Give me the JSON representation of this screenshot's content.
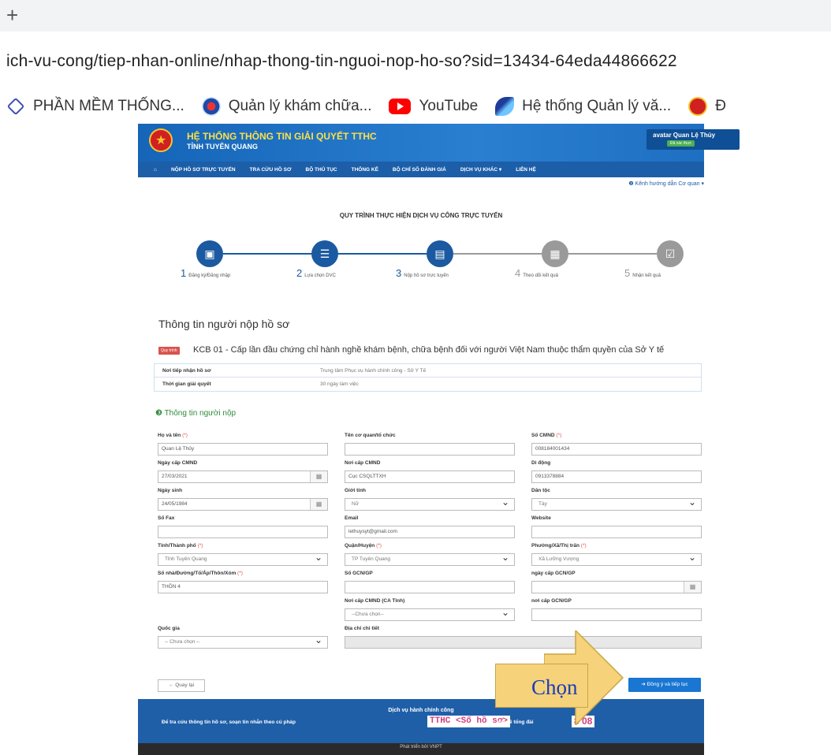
{
  "browser": {
    "new_tab": "+",
    "url": "ich-vu-cong/tiep-nhan-online/nhap-thong-tin-nguoi-nop-ho-so?sid=13434-64eda44866622",
    "bookmarks": [
      {
        "label": "PHẦN MỀM THỐNG...",
        "icon": "layers-icon",
        "color": "#3f51b5"
      },
      {
        "label": "Quản lý khám chữa...",
        "icon": "health-emblem-icon",
        "color": "#1e4aa8"
      },
      {
        "label": "YouTube",
        "icon": "youtube-icon",
        "color": "#ff0000"
      },
      {
        "label": "Hệ thống Quản lý vă...",
        "icon": "bird-logo-icon",
        "color": "#1e3c9a"
      },
      {
        "label": "Đ",
        "icon": "emblem-icon",
        "color": "#d02020"
      }
    ]
  },
  "header": {
    "title": "HỆ THỐNG THÔNG TIN GIẢI QUYẾT TTHC",
    "subtitle": "TỈNH TUYÊN QUANG",
    "user": "avatar Quan Lệ Thủy",
    "user_badge": "Đã xác thực"
  },
  "nav": {
    "home_icon": "⌂",
    "items": [
      "NỘP HỒ SƠ TRỰC TUYẾN",
      "TRA CỨU HỒ SƠ",
      "BỘ THỦ TỤC",
      "THỐNG KÊ",
      "BỘ CHỈ SỐ ĐÁNH GIÁ",
      "DỊCH VỤ KHÁC ▾",
      "LIÊN HỆ"
    ],
    "sub": "❷ Kênh hướng dẫn   Cơ quan ▾"
  },
  "process": {
    "title": "QUY TRÌNH THỰC HIỆN DỊCH VỤ CÔNG TRỰC TUYẾN",
    "steps": [
      {
        "num": "1",
        "label": "Đăng ký/Đăng nhập",
        "icon": "▣"
      },
      {
        "num": "2",
        "label": "Lựa chọn DVC",
        "icon": "☰"
      },
      {
        "num": "3",
        "label": "Nộp hồ sơ trực tuyến",
        "icon": "▤"
      },
      {
        "num": "4",
        "label": "Theo dõi kết quả",
        "icon": "▦"
      },
      {
        "num": "5",
        "label": "Nhận kết quả",
        "icon": "☑"
      }
    ]
  },
  "form": {
    "heading": "Thông tin người nộp hồ sơ",
    "proc_badge": "Quy trình",
    "proc_name": "KCB 01 - Cấp lần đầu chứng chỉ hành nghề khám bệnh, chữa bệnh đối với người Việt Nam thuộc thẩm quyền của Sở Y tế",
    "info": [
      {
        "k": "Nơi tiếp nhận hồ sơ",
        "v": "Trung tâm Phục vụ hành chính công - Sở Y Tế"
      },
      {
        "k": "Thời gian giải quyết",
        "v": "30 ngày làm việc"
      }
    ],
    "section": "❸ Thông tin người nộp",
    "fields": {
      "ho_ten": {
        "label": "Họ và tên",
        "value": "Quan Lệ Thủy",
        "req": "(*)"
      },
      "ten_co_quan": {
        "label": "Tên cơ quan/tổ chức",
        "value": ""
      },
      "so_cmnd": {
        "label": "Số CMND",
        "value": "008184001434",
        "req": "(*)"
      },
      "ngay_cap": {
        "label": "Ngày cấp CMND",
        "value": "27/03/2021"
      },
      "noi_cap": {
        "label": "Nơi cấp CMND",
        "value": "Cục CSQLTTXH"
      },
      "di_dong": {
        "label": "Di động",
        "value": "0913378884"
      },
      "ngay_sinh": {
        "label": "Ngày sinh",
        "value": "24/05/1984"
      },
      "gioi_tinh": {
        "label": "Giới tính",
        "value": "Nữ"
      },
      "dan_toc": {
        "label": "Dân tộc",
        "value": "Tày"
      },
      "so_fax": {
        "label": "Số Fax",
        "value": ""
      },
      "email": {
        "label": "Email",
        "value": "lethuysyt@gmail.com"
      },
      "website": {
        "label": "Website",
        "value": ""
      },
      "tinh": {
        "label": "Tỉnh/Thành phố",
        "value": "Tỉnh Tuyên Quang",
        "req": "(*)"
      },
      "quan": {
        "label": "Quận/Huyện",
        "value": "TP Tuyên Quang",
        "req": "(*)"
      },
      "phuong": {
        "label": "Phường/Xã/Thị trấn",
        "value": "Xã Lưỡng Vượng",
        "req": "(*)"
      },
      "so_nha": {
        "label": "Số nhà/Đường/Tổ/Ấp/Thôn/Xóm",
        "value": "THÔN 4",
        "req": "(*)"
      },
      "so_gcn": {
        "label": "Số GCN/GP",
        "value": ""
      },
      "ngay_gcn": {
        "label": "ngày cấp GCN/GP",
        "value": ""
      },
      "noi_cmnd_ca": {
        "label": "Nơi cấp CMND (CA Tỉnh)",
        "value": "--Chưa chọn--"
      },
      "noi_gcn": {
        "label": "nơi cấp GCN/GP",
        "value": ""
      },
      "quoc_gia": {
        "label": "Quốc gia",
        "value": "-- Chưa chọn --"
      },
      "dia_chi": {
        "label": "Địa chỉ chi tiết",
        "value": ""
      }
    },
    "back": "← Quay lại",
    "next": "➔ Đồng ý và tiếp tục"
  },
  "footer": {
    "line1": "Dịch vụ hành chính công",
    "line2": "Để tra cứu thông tin hồ sơ, soạn tin nhắn theo cú pháp",
    "code": "TTHC <Số hồ sơ>",
    "line3": "gửi về tổng đài",
    "number": "8  08",
    "credit": "Phát triển bởi VNPT"
  },
  "annotation": {
    "label": "Chọn",
    "box_color": "#f6d27a",
    "text_color": "#1a3db8"
  }
}
